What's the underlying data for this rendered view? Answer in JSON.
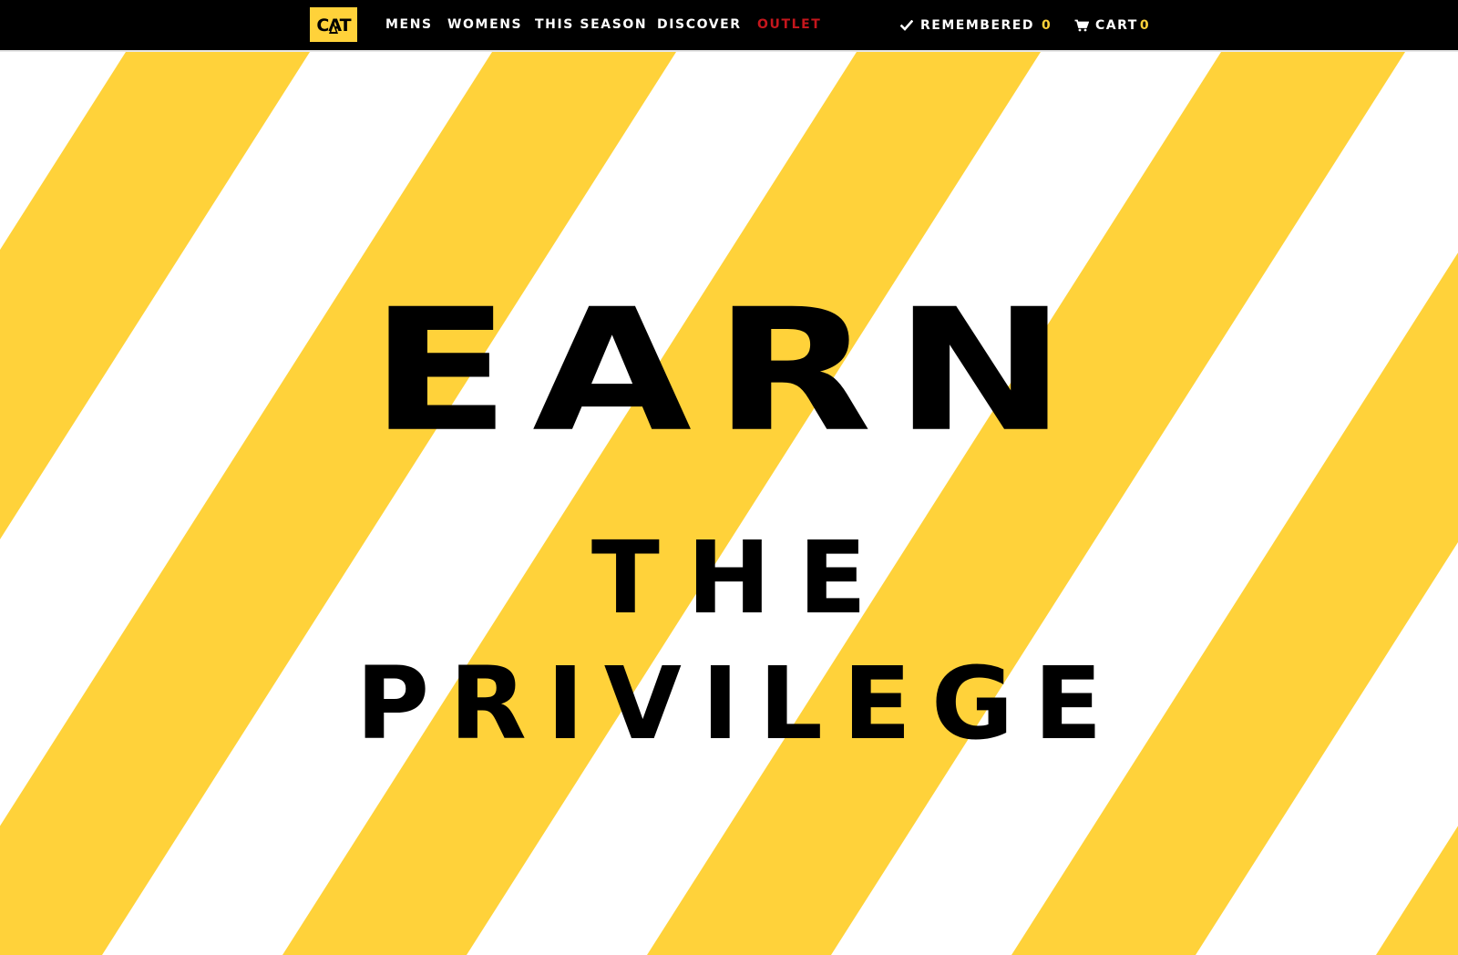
{
  "brand": {
    "logo_text": "CAT",
    "logo_color": "#ffd23a"
  },
  "nav": {
    "items": [
      {
        "label": "MENS"
      },
      {
        "label": "WOMENS"
      },
      {
        "label": "THIS SEASON"
      },
      {
        "label": "DISCOVER"
      },
      {
        "label": "OUTLET"
      }
    ],
    "outlet_color": "#c4161c"
  },
  "utility": {
    "remembered": {
      "label": "REMEMBERED",
      "count": "0",
      "icon": "check-icon"
    },
    "cart": {
      "label": "CART",
      "count": "0",
      "icon": "cart-icon"
    },
    "count_color": "#ffd23a"
  },
  "hero": {
    "line1": "EARN",
    "line2": "THE",
    "line3": "PRIVILEGE",
    "stripe_color": "#ffd23a",
    "background_color": "#ffffff"
  }
}
